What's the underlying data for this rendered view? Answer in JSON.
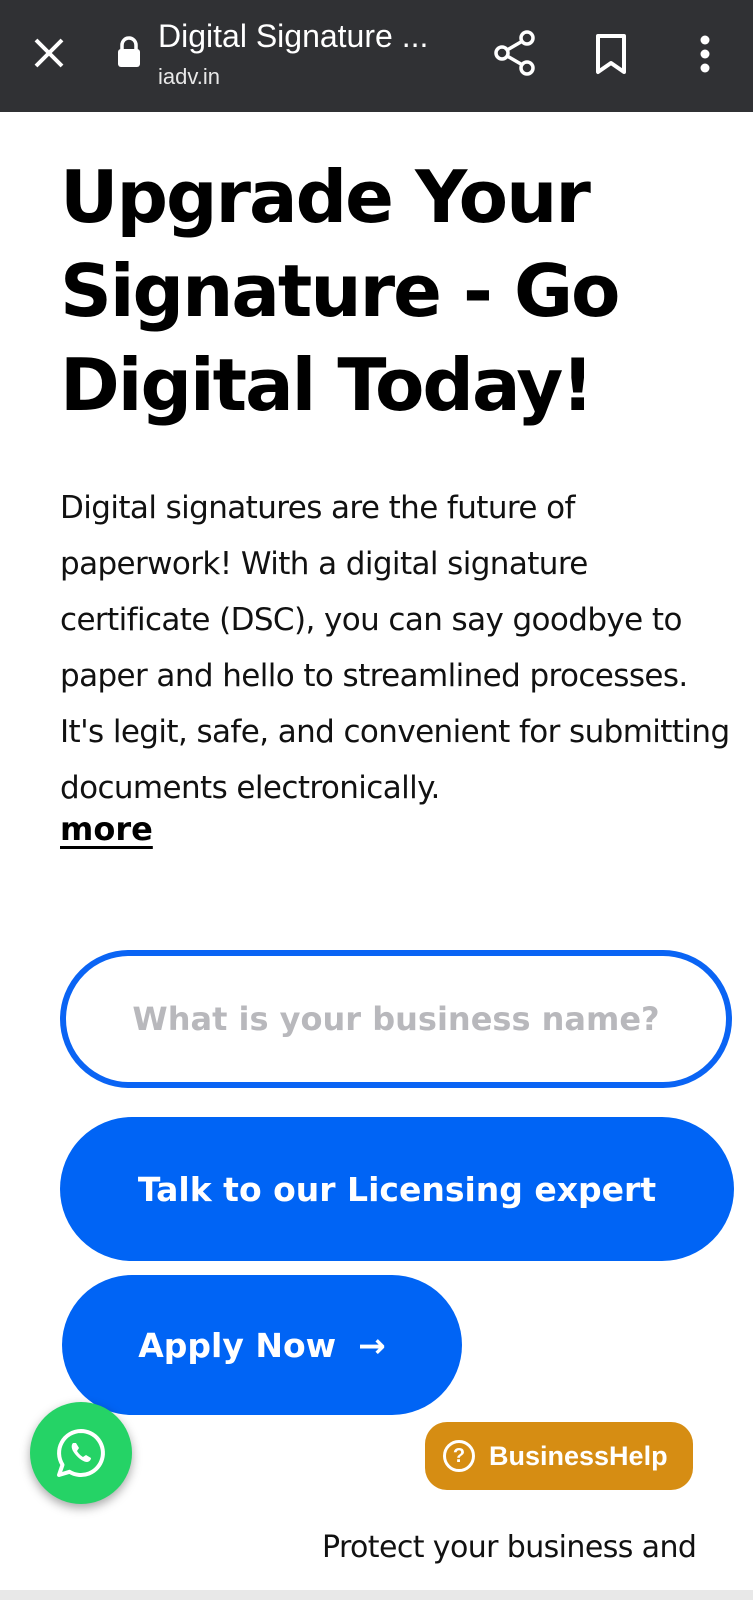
{
  "browser": {
    "title": "Digital Signature ...",
    "url": "iadv.in"
  },
  "hero": {
    "headline": "Upgrade Your Signature - Go Digital Today!",
    "body": "Digital signatures are the future of paperwork! With a digital signature certificate (DSC), you can say goodbye to paper and hello to streamlined processes. It's legit, safe, and convenient for submitting documents electronically.",
    "more_label": "more"
  },
  "form": {
    "business_placeholder": "What is your business name?",
    "talk_label": "Talk to our Licensing expert",
    "apply_label": "Apply Now",
    "apply_arrow": "→"
  },
  "help": {
    "icon_glyph": "?",
    "label": "BusinessHelp"
  },
  "footer_text": "Protect your business and",
  "colors": {
    "toolbar": "#303134",
    "primary": "#0064f5",
    "whatsapp": "#25d366",
    "help": "#d68d13"
  }
}
